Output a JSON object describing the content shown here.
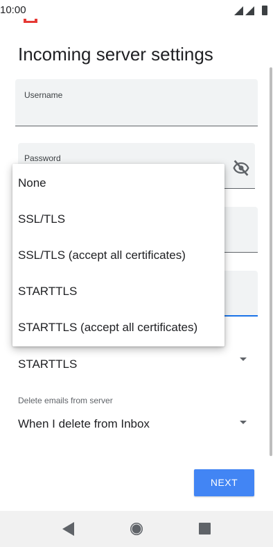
{
  "status_bar": {
    "time": "10:00",
    "icons": [
      "notification-icon",
      "signal-icon",
      "signal-icon",
      "battery-icon"
    ]
  },
  "page": {
    "title": "Incoming server settings"
  },
  "form": {
    "username_label": "Username",
    "password_label": "Password",
    "security_value": "STARTTLS",
    "delete_label": "Delete emails from server",
    "delete_value": "When I delete from Inbox"
  },
  "menu": {
    "items": [
      "None",
      "SSL/TLS",
      "SSL/TLS (accept all certificates)",
      "STARTTLS",
      "STARTTLS (accept all certificates)"
    ]
  },
  "actions": {
    "next_label": "NEXT"
  },
  "colors": {
    "accent": "#4285f4",
    "focus": "#1a73e8",
    "field_bg": "#f1f3f4"
  }
}
